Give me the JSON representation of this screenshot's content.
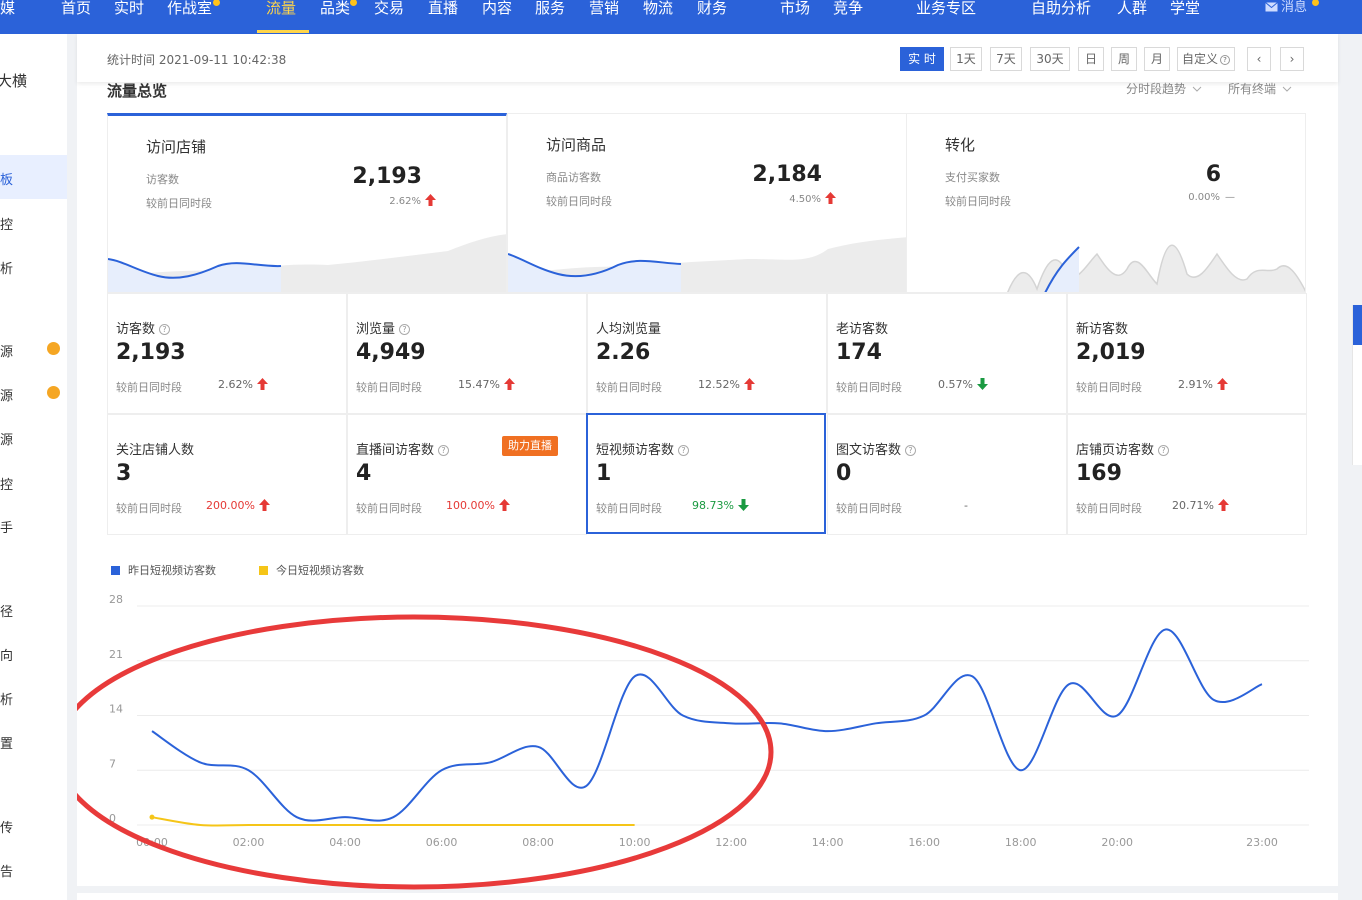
{
  "nav": {
    "items": [
      "首页",
      "实时",
      "作战室",
      "流量",
      "品类",
      "交易",
      "直播",
      "内容",
      "服务",
      "营销",
      "物流",
      "财务",
      "市场",
      "竞争",
      "业务专区",
      "自助分析",
      "人群",
      "学堂"
    ],
    "left_partial": "媒",
    "active": "流量",
    "messages": "消息"
  },
  "sidebar": {
    "items": [
      "大横",
      "板",
      "控",
      "析",
      "源",
      "源",
      "源",
      "控",
      "手",
      "径",
      "向",
      "析",
      "置",
      "传",
      "告"
    ]
  },
  "toolbar": {
    "stat_time_label": "统计时间 2021-09-11 10:42:38",
    "buttons": [
      "实 时",
      "1天",
      "7天",
      "30天",
      "日",
      "周",
      "月",
      "自定义",
      "‹",
      "›"
    ],
    "help_mark": "?"
  },
  "section": {
    "title": "流量总览",
    "trend_dropdown": "分时段趋势",
    "terminal_dropdown": "所有终端"
  },
  "summary_cards": [
    {
      "title": "访问店铺",
      "sub_label": "访客数",
      "compare_label": "较前日同时段",
      "value": "2,193",
      "pct": "2.62%",
      "trend": "up"
    },
    {
      "title": "访问商品",
      "sub_label": "商品访客数",
      "compare_label": "较前日同时段",
      "value": "2,184",
      "pct": "4.50%",
      "trend": "up"
    },
    {
      "title": "转化",
      "sub_label": "支付买家数",
      "compare_label": "较前日同时段",
      "value": "6",
      "pct": "0.00%",
      "trend": "flat",
      "flat_mark": "—"
    }
  ],
  "metrics": [
    {
      "label": "访客数",
      "help": true,
      "value": "2,193",
      "compare_label": "较前日同时段",
      "pct": "2.62%",
      "trend": "up",
      "pct_color": "normal"
    },
    {
      "label": "浏览量",
      "help": true,
      "value": "4,949",
      "compare_label": "较前日同时段",
      "pct": "15.47%",
      "trend": "up",
      "pct_color": "normal"
    },
    {
      "label": "人均浏览量",
      "help": false,
      "value": "2.26",
      "compare_label": "较前日同时段",
      "pct": "12.52%",
      "trend": "up",
      "pct_color": "normal"
    },
    {
      "label": "老访客数",
      "help": false,
      "value": "174",
      "compare_label": "较前日同时段",
      "pct": "0.57%",
      "trend": "down",
      "pct_color": "normal"
    },
    {
      "label": "新访客数",
      "help": false,
      "value": "2,019",
      "compare_label": "较前日同时段",
      "pct": "2.91%",
      "trend": "up",
      "pct_color": "normal"
    },
    {
      "label": "关注店铺人数",
      "help": false,
      "value": "3",
      "compare_label": "较前日同时段",
      "pct": "200.00%",
      "trend": "up",
      "pct_color": "red"
    },
    {
      "label": "直播间访客数",
      "help": true,
      "value": "4",
      "compare_label": "较前日同时段",
      "pct": "100.00%",
      "trend": "up",
      "pct_color": "red",
      "badge": "助力直播"
    },
    {
      "label": "短视频访客数",
      "help": true,
      "value": "1",
      "compare_label": "较前日同时段",
      "pct": "98.73%",
      "trend": "down",
      "pct_color": "green",
      "selected": true
    },
    {
      "label": "图文访客数",
      "help": true,
      "value": "0",
      "compare_label": "较前日同时段",
      "pct": "-",
      "trend": "none",
      "pct_color": "normal"
    },
    {
      "label": "店铺页访客数",
      "help": true,
      "value": "169",
      "compare_label": "较前日同时段",
      "pct": "20.71%",
      "trend": "up",
      "pct_color": "normal"
    }
  ],
  "colors": {
    "brand": "#2b62d9",
    "nav_active": "#ffd54a",
    "up_arrow": "#e53935",
    "down_arrow": "#1a9a41",
    "badge": "#f07022",
    "series_yesterday": "#2b62d9",
    "series_today": "#f5c518",
    "annotation_ellipse": "#e83a3a"
  },
  "chart_data": {
    "type": "line",
    "title": "",
    "xlabel": "",
    "ylabel": "",
    "ylim": [
      0,
      28
    ],
    "yticks": [
      0,
      7,
      14,
      21,
      28
    ],
    "xlim": [
      0,
      23
    ],
    "xtick_labels": [
      "00:00",
      "02:00",
      "04:00",
      "06:00",
      "08:00",
      "10:00",
      "12:00",
      "14:00",
      "16:00",
      "18:00",
      "20:00",
      "23:00"
    ],
    "xtick_hours": [
      0,
      2,
      4,
      6,
      8,
      10,
      12,
      14,
      16,
      18,
      20,
      23
    ],
    "grid": true,
    "legend_position": "top-left",
    "series": [
      {
        "name": "昨日短视频访客数",
        "color": "#2b62d9",
        "x": [
          0,
          1,
          2,
          3,
          4,
          5,
          6,
          7,
          8,
          9,
          10,
          11,
          12,
          13,
          14,
          15,
          16,
          17,
          18,
          19,
          20,
          21,
          22,
          23
        ],
        "values": [
          12,
          8,
          7,
          1,
          1,
          1,
          7,
          8,
          10,
          5,
          19,
          14,
          13,
          13,
          12,
          13,
          14,
          19,
          7,
          18,
          14,
          25,
          16,
          18
        ]
      },
      {
        "name": "今日短视频访客数",
        "color": "#f5c518",
        "x": [
          0,
          1,
          2,
          3,
          4,
          5,
          6,
          7,
          8,
          9,
          10
        ],
        "values": [
          1,
          0,
          0,
          0,
          0,
          0,
          0,
          0,
          0,
          0,
          0
        ]
      }
    ]
  }
}
